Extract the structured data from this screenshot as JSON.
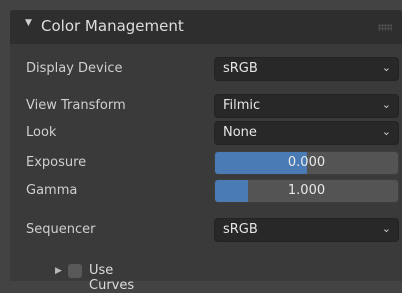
{
  "panel": {
    "title": "Color Management",
    "collapse_icon": "triangle-down-icon",
    "drag_icon": "grip-icon"
  },
  "rows": {
    "display_device": {
      "label": "Display Device",
      "value": "sRGB"
    },
    "view_transform": {
      "label": "View Transform",
      "value": "Filmic"
    },
    "look": {
      "label": "Look",
      "value": "None"
    },
    "exposure": {
      "label": "Exposure",
      "value": "0.000",
      "fill_fraction": 0.5
    },
    "gamma": {
      "label": "Gamma",
      "value": "1.000",
      "fill_fraction": 0.18
    },
    "sequencer": {
      "label": "Sequencer",
      "value": "sRGB"
    }
  },
  "use_curves": {
    "label": "Use Curves",
    "checked": false
  },
  "colors": {
    "accent": "#4a7bb5",
    "panel": "#3a3a3a",
    "header": "#2e2e2e"
  }
}
